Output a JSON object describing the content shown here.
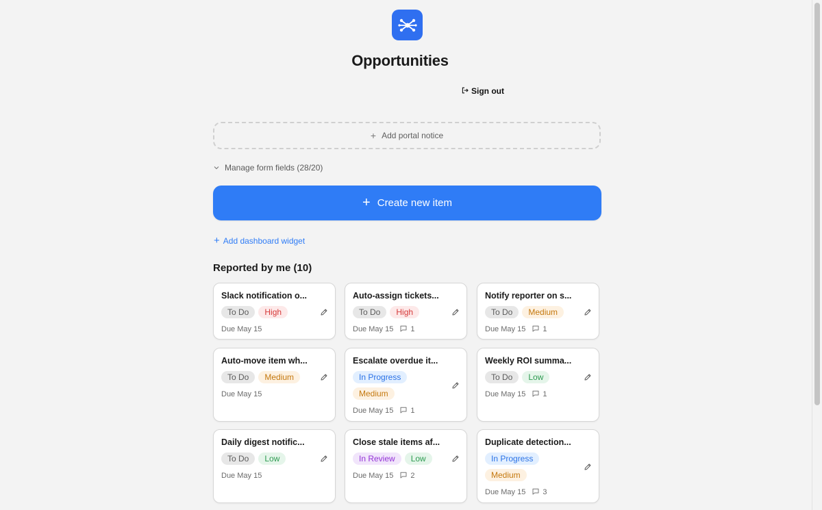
{
  "header": {
    "title": "Opportunities",
    "logo_icon": "network-nodes-icon",
    "signout_label": "Sign out",
    "accent_color": "#2f7cf6"
  },
  "notice": {
    "label": "Add portal notice"
  },
  "form_fields": {
    "label": "Manage form fields (28/20)"
  },
  "create_button": {
    "label": "Create new item"
  },
  "widget": {
    "label": "Add dashboard widget"
  },
  "section": {
    "title": "Reported by me (10)"
  },
  "cards": [
    {
      "title": "Slack notification o...",
      "status": "To Do",
      "priority": "High",
      "due": "Due May 15",
      "comments": ""
    },
    {
      "title": "Auto-assign tickets...",
      "status": "To Do",
      "priority": "High",
      "due": "Due May 15",
      "comments": "1"
    },
    {
      "title": "Notify reporter on s...",
      "status": "To Do",
      "priority": "Medium",
      "due": "Due May 15",
      "comments": "1"
    },
    {
      "title": "Auto-move item wh...",
      "status": "To Do",
      "priority": "Medium",
      "due": "Due May 15",
      "comments": ""
    },
    {
      "title": "Escalate overdue it...",
      "status": "In Progress",
      "priority": "Medium",
      "due": "Due May 15",
      "comments": "1"
    },
    {
      "title": "Weekly ROI summa...",
      "status": "To Do",
      "priority": "Low",
      "due": "Due May 15",
      "comments": "1"
    },
    {
      "title": "Daily digest notific...",
      "status": "To Do",
      "priority": "Low",
      "due": "Due May 15",
      "comments": ""
    },
    {
      "title": "Close stale items af...",
      "status": "In Review",
      "priority": "Low",
      "due": "Due May 15",
      "comments": "2"
    },
    {
      "title": "Duplicate detection...",
      "status": "In Progress",
      "priority": "Medium",
      "due": "Due May 15",
      "comments": "3"
    }
  ]
}
